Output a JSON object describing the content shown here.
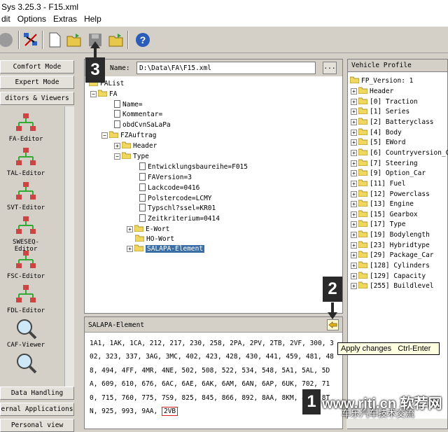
{
  "window": {
    "title": "Sys 3.25.3 - F15.xml"
  },
  "menu": [
    "dit",
    "Options",
    "Extras",
    "Help"
  ],
  "left": {
    "buttons_top": [
      "Comfort Mode",
      "Expert Mode",
      "ditors & Viewers"
    ],
    "tools": [
      "FA-Editor",
      "TAL-Editor",
      "SVT-Editor",
      "SWESEQ-Editor",
      "FSC-Editor",
      "FDL-Editor",
      "CAF-Viewer"
    ],
    "buttons_bottom": [
      "Data Handling",
      "ernal Applications",
      "Personal view"
    ]
  },
  "center": {
    "name_label": "Name:",
    "name_value": "D:\\Data\\FA\\F15.xml",
    "browse_label": "...",
    "tree": {
      "root": "FAList",
      "fa": "FA",
      "name": "Name=",
      "kommentar": "Kommentar=",
      "obd": "obdCvnSaLaPa",
      "fzauftrag": "FZAuftrag",
      "header": "Header",
      "type": "Type",
      "type_items": [
        "Entwicklungsbaureihe=F015",
        "FAVersion=3",
        "Lackcode=0416",
        "Polstercode=LCMY",
        "Typschl?ssel=KR01",
        "Zeitkriterium=0414"
      ],
      "ewort": "E-Wort",
      "howort": "HO-Wort",
      "salapa": "SALAPA-Element"
    }
  },
  "right": {
    "title": "Vehicle Profile",
    "root": "FP_Version: 1",
    "items": [
      "Header",
      "[0] Traction",
      "[1] Series",
      "[2] Batteryclass",
      "[4] Body",
      "[5] EWord",
      "[6] Countryversion_C",
      "[7] Steering",
      "[9] Option_Car",
      "[11] Fuel",
      "[12] Powerclass",
      "[13] Engine",
      "[15] Gearbox",
      "[17] Type",
      "[19] Bodylength",
      "[23] Hybridtype",
      "[29] Package_Car",
      "[128] Cylinders",
      "[129] Capacity",
      "[255] Buildlevel"
    ]
  },
  "bottom": {
    "title": "SALAPA-Element",
    "text": "1A1, 1AK, 1CA, 212, 217, 230, 258, 2PA, 2PV, 2TB, 2VF, 300, 302, 323, 337, 3AG, 3MC, 402, 423, 428, 430, 441, 459, 481, 488, 494, 4FF, 4MR, 4NE, 502, 508, 522, 534, 548, 5A1, 5AL, 5DA, 609, 610, 676, 6AC, 6AE, 6AK, 6AM, 6AN, 6AP, 6UK, 702, 710, 715, 760, 775, 7S9, 825, 845, 866, 892, 8AA, 8KM, 8SM, 8TN, 925, 993, 9AA,",
    "highlight": "2VB"
  },
  "tooltip": {
    "label": "Apply changes",
    "shortcut": "Ctrl-Enter"
  },
  "badges": [
    "3",
    "2",
    "1"
  ],
  "watermark": {
    "url": "www.rjtj.cn",
    "cn": "软荐网",
    "sub": "车乐汽车技术交流"
  }
}
